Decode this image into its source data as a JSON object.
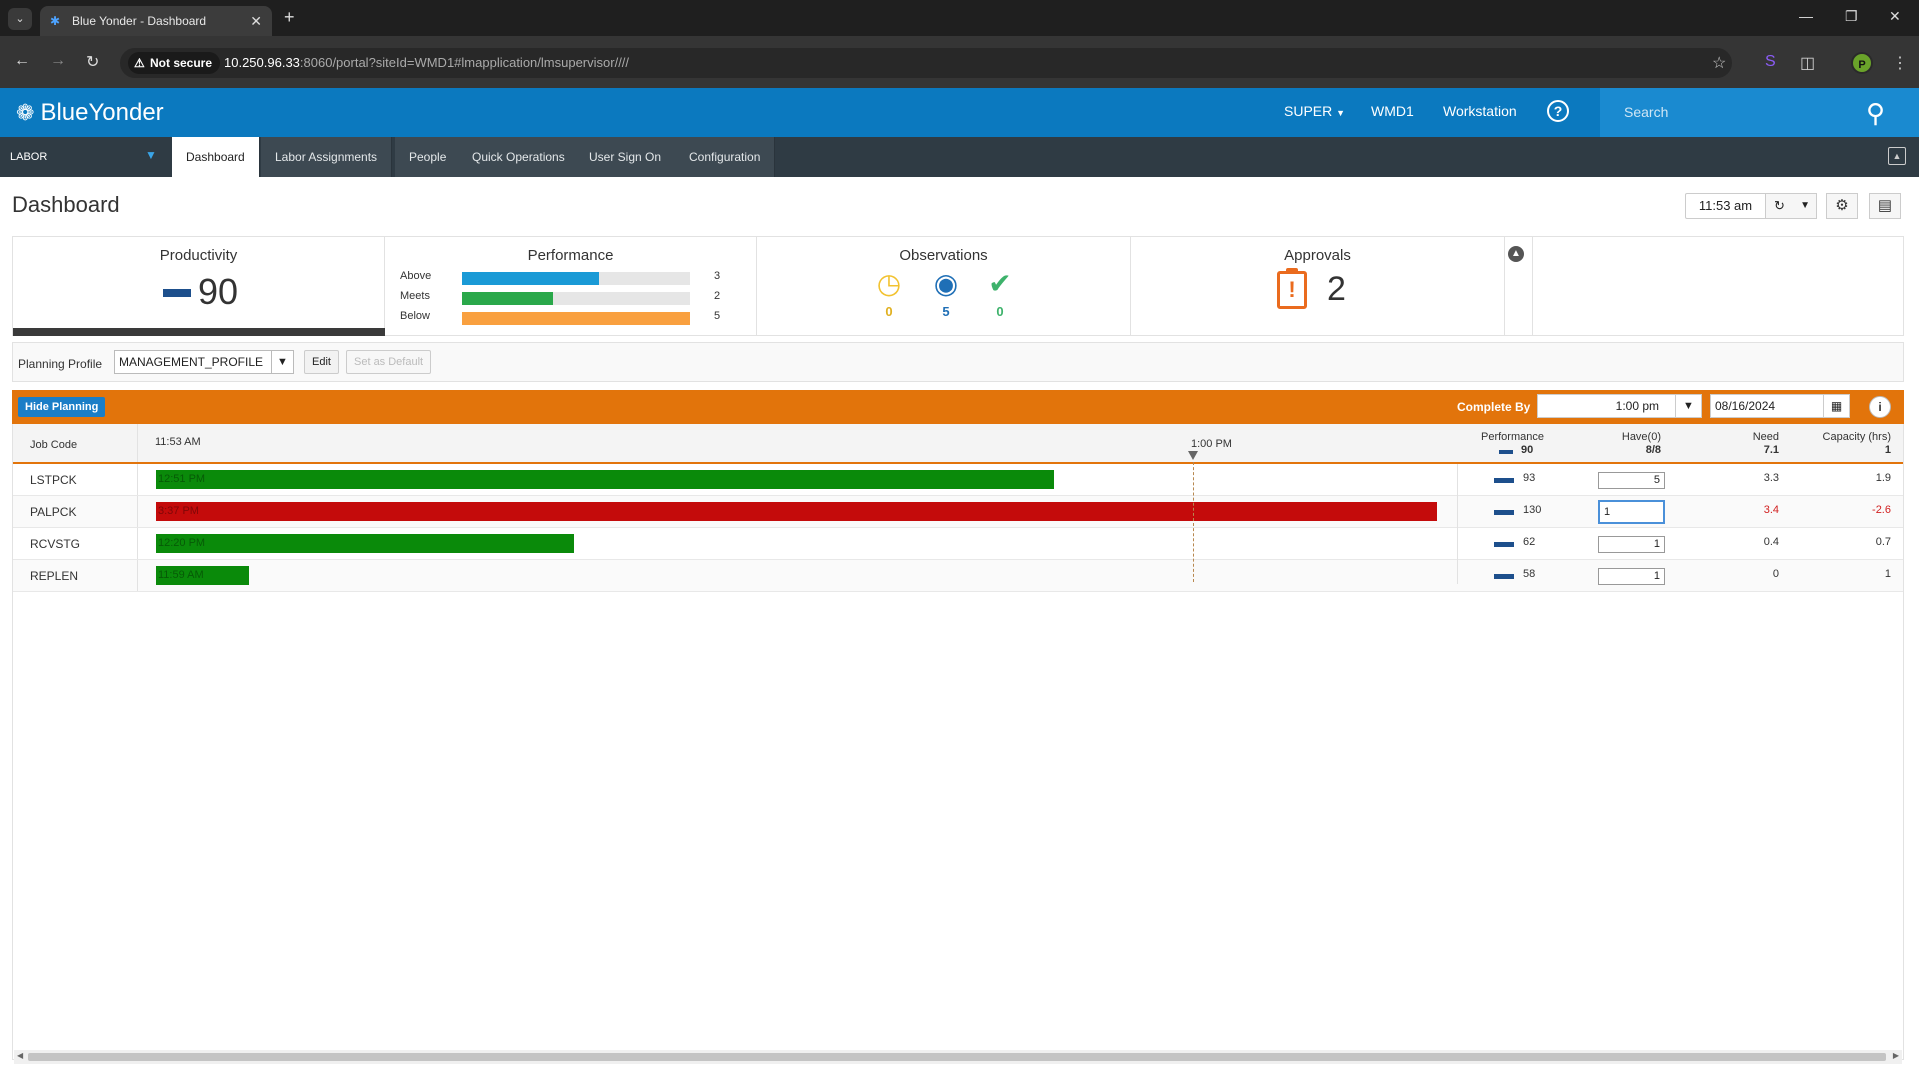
{
  "browser": {
    "tab_title": "Blue Yonder - Dashboard",
    "not_secure": "Not secure",
    "url_host": "10.250.96.33",
    "url_rest": ":8060/portal?siteId=WMD1#lmapplication/lmsupervisor////",
    "profile_initial": "P"
  },
  "header": {
    "logo_text": "BlueYonder",
    "user": "SUPER",
    "site": "WMD1",
    "workstation": "Workstation",
    "help": "?",
    "search_placeholder": "Search"
  },
  "nav": {
    "module": "LABOR",
    "tabs": [
      "Dashboard",
      "Labor Assignments",
      "People",
      "Quick Operations",
      "User Sign On",
      "Configuration"
    ]
  },
  "page": {
    "title": "Dashboard",
    "time": "11:53 am"
  },
  "kpi": {
    "productivity": {
      "title": "Productivity",
      "value": "90"
    },
    "performance": {
      "title": "Performance",
      "rows": [
        {
          "label": "Above",
          "count": "3",
          "fraction": 0.6,
          "color": "#1a9ad6"
        },
        {
          "label": "Meets",
          "count": "2",
          "fraction": 0.4,
          "color": "#2aa84a"
        },
        {
          "label": "Below",
          "count": "5",
          "fraction": 1.0,
          "color": "#f9a03f"
        }
      ]
    },
    "observations": {
      "title": "Observations",
      "items": [
        {
          "icon": "clock-icon",
          "count": "0",
          "color": "#f2c230"
        },
        {
          "icon": "eye-icon",
          "count": "5",
          "color": "#1f6fb6"
        },
        {
          "icon": "check-circle-icon",
          "count": "0",
          "color": "#3db26b"
        }
      ]
    },
    "approvals": {
      "title": "Approvals",
      "value": "2"
    }
  },
  "planning_profile": {
    "label": "Planning Profile",
    "value": "MANAGEMENT_PROFILE",
    "edit": "Edit",
    "set_default": "Set as Default"
  },
  "planning": {
    "hide_button": "Hide Planning",
    "complete_by_label": "Complete By",
    "complete_by_time": "1:00 pm",
    "complete_by_date": "08/16/2024"
  },
  "grid": {
    "headers": {
      "job_code": "Job Code",
      "start_time": "11:53 AM",
      "end_time": "1:00 PM",
      "performance": "Performance",
      "performance_sub": "90",
      "have": "Have(0)",
      "have_sub": "8/8",
      "need": "Need",
      "need_sub": "7.1",
      "capacity": "Capacity (hrs)",
      "capacity_sub": "1"
    },
    "rows": [
      {
        "job": "LSTPCK",
        "bar_label": "12:51 PM",
        "bar_color": "#0a8a0a",
        "performance": "93",
        "have": "5",
        "need": "3.3",
        "capacity": "1.9"
      },
      {
        "job": "PALPCK",
        "bar_label": "3:37 PM",
        "bar_color": "#c40b0b",
        "performance": "130",
        "have": "1",
        "need": "3.4",
        "capacity": "-2.6"
      },
      {
        "job": "RCVSTG",
        "bar_label": "12:20 PM",
        "bar_color": "#0a8a0a",
        "performance": "62",
        "have": "1",
        "need": "0.4",
        "capacity": "0.7"
      },
      {
        "job": "REPLEN",
        "bar_label": "11:59 AM",
        "bar_color": "#0a8a0a",
        "performance": "58",
        "have": "1",
        "need": "0",
        "capacity": "1"
      }
    ]
  }
}
